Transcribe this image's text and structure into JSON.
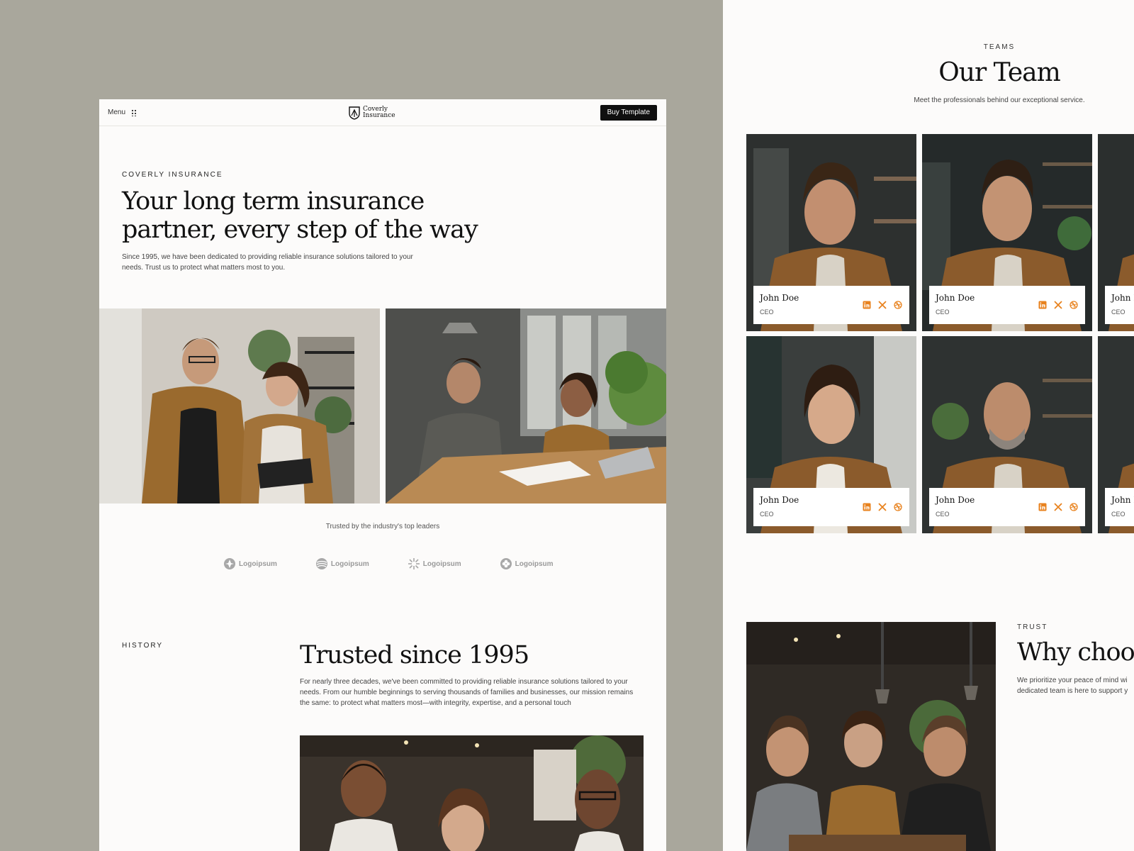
{
  "left": {
    "topbar": {
      "menu_label": "Menu",
      "brand_name": "Coverly\nInsurance",
      "buy_button": "Buy Template"
    },
    "hero": {
      "kicker": "COVERLY INSURANCE",
      "title": "Your long term insurance partner, every step of the way",
      "text": "Since 1995, we have been dedicated to providing reliable insurance solutions tailored to your needs. Trust us to protect what matters most to you."
    },
    "trusted": {
      "text": "Trusted by the industry's top leaders",
      "logos": [
        "Logoipsum",
        "Logoipsum",
        "Logoipsum",
        "Logoipsum"
      ]
    },
    "history": {
      "kicker": "HISTORY",
      "title": "Trusted since 1995",
      "text": "For nearly three decades, we've been committed to providing reliable insurance solutions tailored to your needs. From our humble beginnings to serving thousands of families and businesses, our mission remains the same: to protect what matters most—with integrity, expertise, and a personal touch"
    }
  },
  "right": {
    "teams": {
      "kicker": "TEAMS",
      "title": "Our Team",
      "text": "Meet the professionals behind our exceptional service.",
      "members": [
        {
          "name": "John Doe",
          "role": "CEO"
        },
        {
          "name": "John Doe",
          "role": "CEO"
        },
        {
          "name": "John Doe",
          "role": "CEO"
        },
        {
          "name": "John Doe",
          "role": "CEO"
        },
        {
          "name": "John Doe",
          "role": "CEO"
        },
        {
          "name": "John Doe",
          "role": "CEO"
        }
      ]
    },
    "trust": {
      "kicker": "TRUST",
      "title": "Why choose",
      "text": "We prioritize your peace of mind wi\ndedicated team is here to support y"
    }
  },
  "colors": {
    "backdrop": "#a9a79c",
    "page": "#fcfbfa",
    "social_accent": "#e8821e",
    "button": "#0f0f0f"
  },
  "icons": {
    "menu": "grid-dots-icon",
    "brand": "shield-logo-icon",
    "socials": [
      "linkedin-icon",
      "x-icon",
      "dribbble-icon"
    ]
  }
}
